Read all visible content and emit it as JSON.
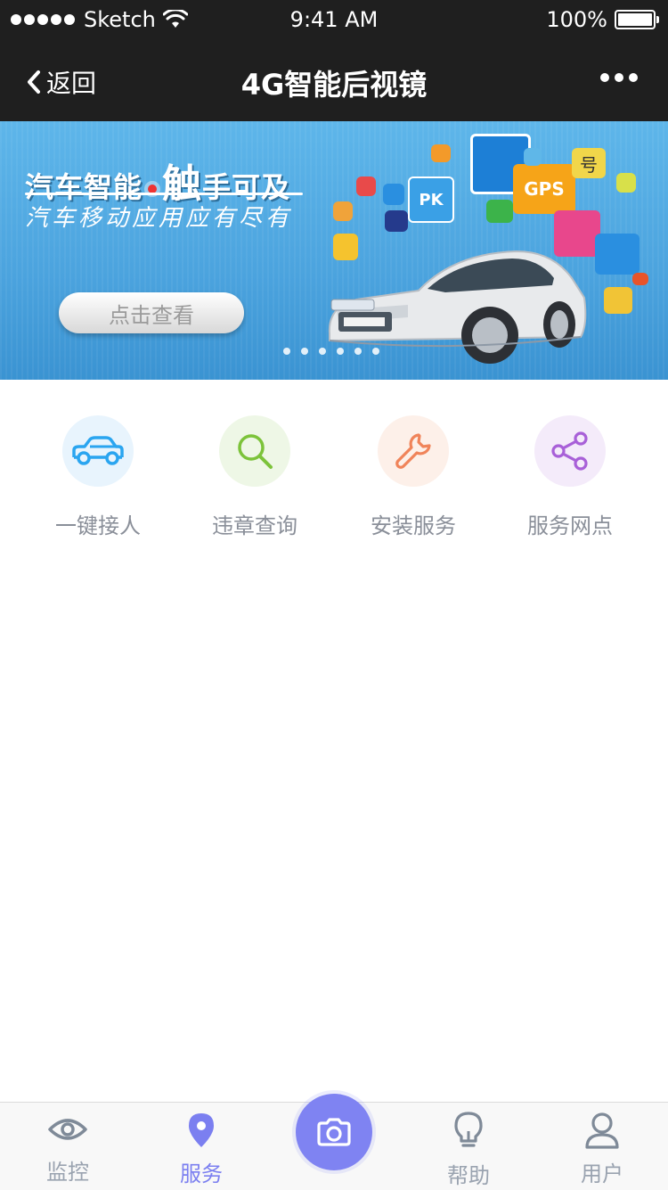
{
  "status_bar": {
    "carrier": "Sketch",
    "time": "9:41 AM",
    "battery": "100%"
  },
  "nav": {
    "back_label": "返回",
    "title": "4G智能后视镜"
  },
  "banner": {
    "title_part1": "汽车智能",
    "title_big": "触",
    "title_part2": "手可及",
    "subtitle": "汽车移动应用应有尽有",
    "button_label": "点击查看",
    "badge_pk": "PK",
    "badge_gps": "GPS",
    "badge_hao": "号",
    "slide_count": 6
  },
  "services": [
    {
      "label": "一键接人",
      "icon": "car-icon",
      "color": "#2aa5f0",
      "bg": "#e8f4fd"
    },
    {
      "label": "违章查询",
      "icon": "search-icon",
      "color": "#7cc33a",
      "bg": "#eef7e6"
    },
    {
      "label": "安装服务",
      "icon": "wrench-icon",
      "color": "#f0845a",
      "bg": "#fdf0e9"
    },
    {
      "label": "服务网点",
      "icon": "share-icon",
      "color": "#a860d8",
      "bg": "#f4ebfa"
    }
  ],
  "tabs": [
    {
      "label": "监控",
      "icon": "eye-icon",
      "active": false
    },
    {
      "label": "服务",
      "icon": "location-pin-icon",
      "active": true
    },
    {
      "label": "",
      "icon": "camera-icon",
      "active": false
    },
    {
      "label": "帮助",
      "icon": "lightbulb-icon",
      "active": false
    },
    {
      "label": "用户",
      "icon": "user-icon",
      "active": false
    }
  ],
  "colors": {
    "accent": "#7b7ff0",
    "nav_bg": "#1f1f1f",
    "tab_inactive": "#9aa3b0"
  }
}
